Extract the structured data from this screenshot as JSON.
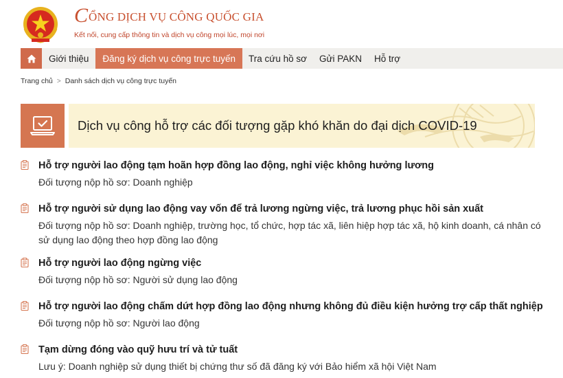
{
  "header": {
    "title_initial": "C",
    "title_rest": "ỔNG DỊCH VỤ CÔNG QUỐC GIA",
    "subtitle": "Kết nối, cung cấp thông tin và dịch vụ công mọi lúc, mọi nơi",
    "emblem_icon": "national-emblem-icon"
  },
  "nav": {
    "home_icon": "home-icon",
    "items": [
      {
        "label": "Giới thiệu"
      },
      {
        "label": "Đăng ký dịch vụ công trực tuyến"
      },
      {
        "label": "Tra cứu hồ sơ"
      },
      {
        "label": "Gửi PAKN"
      },
      {
        "label": "Hỗ trợ"
      }
    ],
    "active_index": 1
  },
  "breadcrumb": {
    "home": "Trang chủ",
    "separator": ">",
    "current": "Danh sách dịch vụ công trực tuyến"
  },
  "banner": {
    "icon": "laptop-check-icon",
    "title": "Dịch vụ công hỗ trợ các đối tượng gặp khó khăn do đại dịch COVID-19"
  },
  "services": [
    {
      "title": "Hỗ trợ người lao động tạm hoãn hợp đồng lao động, nghỉ việc không hưởng lương",
      "desc": "Đối tượng nộp hồ sơ: Doanh nghiệp"
    },
    {
      "title": "Hỗ trợ người sử dụng lao động vay vốn để trả lương ngừng việc, trả lương phục hồi sản xuất",
      "desc": "Đối tượng nộp hồ sơ: Doanh nghiệp, trường học, tổ chức, hợp tác xã, liên hiệp hợp tác xã, hộ kinh doanh, cá nhân có sử dụng lao động theo hợp đồng lao động"
    },
    {
      "title": "Hỗ trợ người lao động ngừng việc",
      "desc": "Đối tượng nộp hồ sơ: Người sử dụng lao động"
    },
    {
      "title": "Hỗ trợ người lao động chấm dứt hợp đồng lao động nhưng không đủ điều kiện hưởng trợ cấp thất nghiệp",
      "desc": "Đối tượng nộp hồ sơ: Người lao động"
    },
    {
      "title": "Tạm dừng đóng vào quỹ hưu trí và tử tuất",
      "desc": "Lưu ý: Doanh nghiệp sử dụng thiết bị chứng thư số đã đăng ký với Bảo hiểm xã hội Việt Nam"
    }
  ],
  "colors": {
    "accent": "#d57651",
    "nav_bg": "#f0efec",
    "banner_bg": "#fbf3d4",
    "title_red": "#c8502f"
  }
}
